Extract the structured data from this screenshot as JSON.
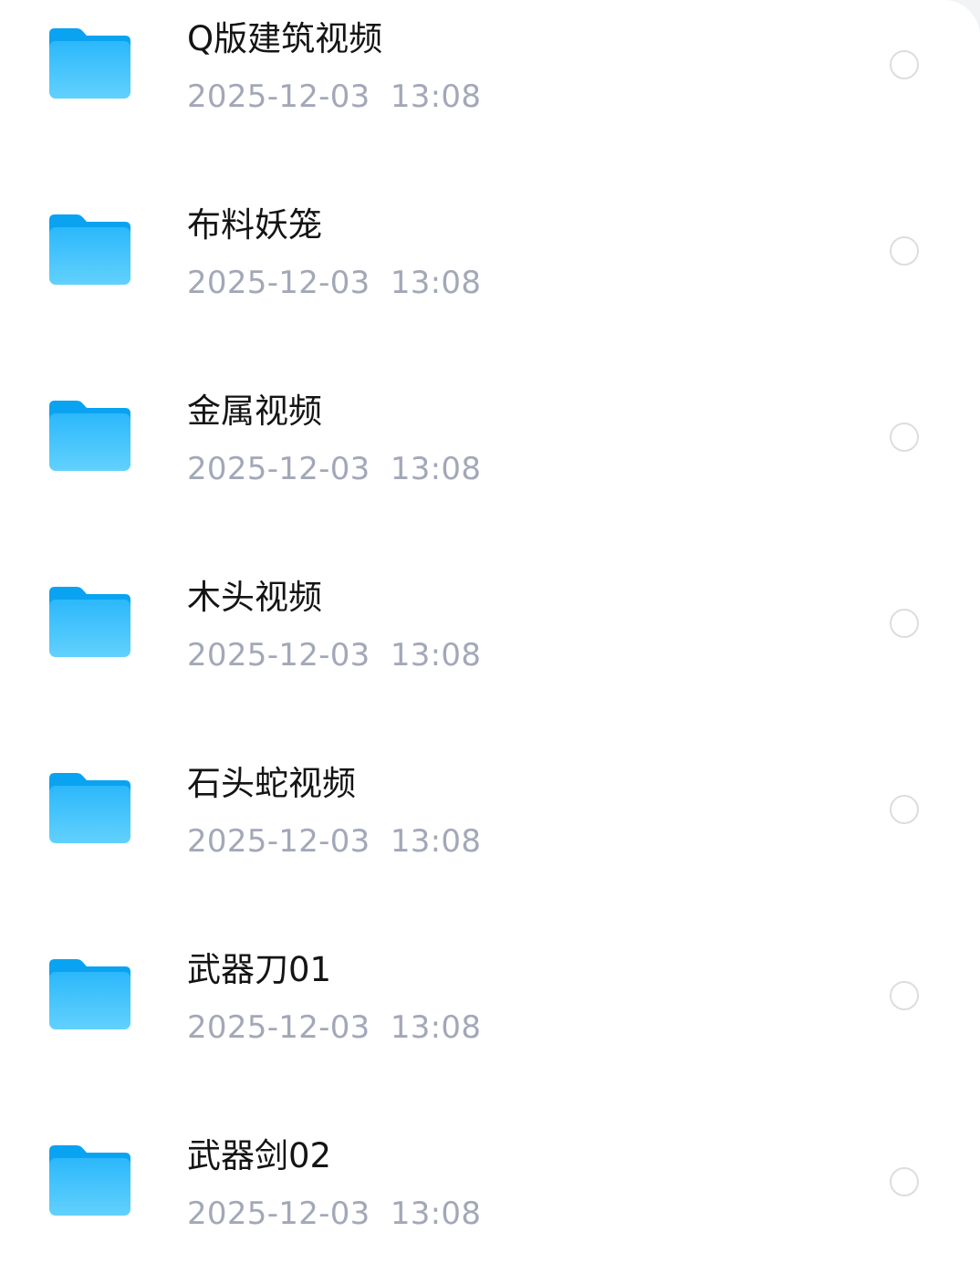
{
  "file_list": {
    "items": [
      {
        "name": "Q版建筑视频",
        "date": "2025-12-03",
        "time": "13:08",
        "selected": false
      },
      {
        "name": "布料妖笼",
        "date": "2025-12-03",
        "time": "13:08",
        "selected": false
      },
      {
        "name": "金属视频",
        "date": "2025-12-03",
        "time": "13:08",
        "selected": false
      },
      {
        "name": "木头视频",
        "date": "2025-12-03",
        "time": "13:08",
        "selected": false
      },
      {
        "name": "石头蛇视频",
        "date": "2025-12-03",
        "time": "13:08",
        "selected": false
      },
      {
        "name": "武器刀01",
        "date": "2025-12-03",
        "time": "13:08",
        "selected": false
      },
      {
        "name": "武器剑02",
        "date": "2025-12-03",
        "time": "13:08",
        "selected": false
      }
    ]
  },
  "icons": {
    "folder": "folder-icon",
    "radio": "radio-unchecked-icon"
  },
  "colors": {
    "folder_top": "#0aa3f2",
    "folder_bottom": "#62d1fd",
    "name_text": "#141414",
    "meta_text": "#a3a8b8",
    "radio_border": "#dcdde0"
  }
}
